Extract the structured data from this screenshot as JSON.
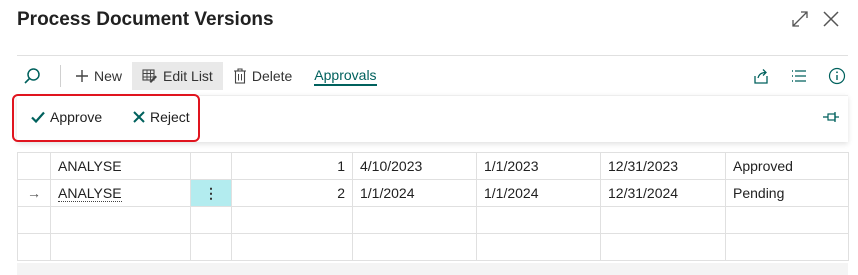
{
  "window": {
    "title": "Process Document Versions",
    "icons": [
      "expand-icon",
      "close-icon"
    ]
  },
  "toolbar": {
    "new_label": "New",
    "edit_list_label": "Edit List",
    "delete_label": "Delete",
    "approvals_label": "Approvals"
  },
  "actions": {
    "approve_label": "Approve",
    "reject_label": "Reject"
  },
  "colors": {
    "accent": "#00615d",
    "highlight_border": "#e0141e",
    "selected_cell": "#b3ecef"
  },
  "table": {
    "rows": [
      {
        "indicator": "",
        "code": "ANALYSE",
        "version": "1",
        "date1": "4/10/2023",
        "date2": "1/1/2023",
        "date3": "12/31/2023",
        "status": "Approved"
      },
      {
        "indicator": "→",
        "code": "ANALYSE",
        "menu": "⋮",
        "version": "2",
        "date1": "1/1/2024",
        "date2": "1/1/2024",
        "date3": "12/31/2024",
        "status": "Pending"
      }
    ]
  }
}
